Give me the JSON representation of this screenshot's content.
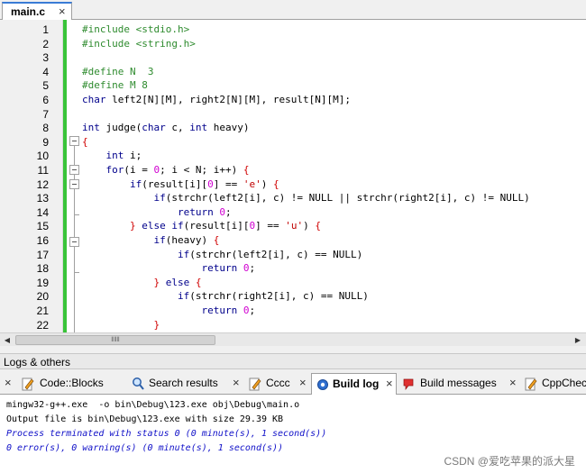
{
  "editor": {
    "tab": {
      "label": "main.c",
      "close": "×"
    },
    "lines": [
      {
        "n": "1",
        "html": "<span class=\"pp\">#include &lt;stdio.h&gt;</span>"
      },
      {
        "n": "2",
        "html": "<span class=\"pp\">#include &lt;string.h&gt;</span>"
      },
      {
        "n": "3",
        "html": ""
      },
      {
        "n": "4",
        "html": "<span class=\"pp\">#define N  3</span>"
      },
      {
        "n": "5",
        "html": "<span class=\"pp\">#define M 8</span>"
      },
      {
        "n": "6",
        "html": "<span class=\"kw\">char</span> left2[N][M], right2[N][M], result[N][M];"
      },
      {
        "n": "7",
        "html": ""
      },
      {
        "n": "8",
        "html": "<span class=\"kw\">int</span> judge(<span class=\"kw\">char</span> c, <span class=\"kw\">int</span> heavy)"
      },
      {
        "n": "9",
        "html": "<span class=\"op\">{</span>"
      },
      {
        "n": "10",
        "html": "    <span class=\"kw\">int</span> i;"
      },
      {
        "n": "11",
        "html": "    <span class=\"kw\">for</span>(i = <span class=\"num\">0</span>; i &lt; N; i++) <span class=\"op\">{</span>"
      },
      {
        "n": "12",
        "html": "        <span class=\"kw\">if</span>(result[i][<span class=\"num\">0</span>] == <span class=\"str\">'e'</span>) <span class=\"op\">{</span>"
      },
      {
        "n": "13",
        "html": "            <span class=\"kw\">if</span>(strchr(left2[i], c) != NULL || strchr(right2[i], c) != NULL)"
      },
      {
        "n": "14",
        "html": "                <span class=\"kw\">return</span> <span class=\"num\">0</span>;"
      },
      {
        "n": "15",
        "html": "        <span class=\"op\">}</span> <span class=\"kw\">else</span> <span class=\"kw\">if</span>(result[i][<span class=\"num\">0</span>] == <span class=\"str\">'u'</span>) <span class=\"op\">{</span>"
      },
      {
        "n": "16",
        "html": "            <span class=\"kw\">if</span>(heavy) <span class=\"op\">{</span>"
      },
      {
        "n": "17",
        "html": "                <span class=\"kw\">if</span>(strchr(left2[i], c) == NULL)"
      },
      {
        "n": "18",
        "html": "                    <span class=\"kw\">return</span> <span class=\"num\">0</span>;"
      },
      {
        "n": "19",
        "html": "            <span class=\"op\">}</span> <span class=\"kw\">else</span> <span class=\"op\">{</span>"
      },
      {
        "n": "20",
        "html": "                <span class=\"kw\">if</span>(strchr(right2[i], c) == NULL)"
      },
      {
        "n": "21",
        "html": "                    <span class=\"kw\">return</span> <span class=\"num\">0</span>;"
      },
      {
        "n": "22",
        "html": "            <span class=\"op\">}</span>"
      }
    ]
  },
  "scrollbar": {
    "thumb_grip": "⦀⦀⦀",
    "left_arrow": "◀",
    "right_arrow": "▶"
  },
  "logs": {
    "title": "Logs & others",
    "tabs": [
      {
        "label": "Code::Blocks",
        "icon": "pencil-icon"
      },
      {
        "label": "Search results",
        "icon": "search-icon"
      },
      {
        "label": "Cccc",
        "icon": "pencil-icon"
      },
      {
        "label": "Build log",
        "icon": "gear-icon",
        "active": true
      },
      {
        "label": "Build messages",
        "icon": "build-messages-icon"
      },
      {
        "label": "CppCheck",
        "icon": "pencil-icon"
      }
    ],
    "close": "×",
    "lines": [
      {
        "text": "mingw32-g++.exe  -o bin\\Debug\\123.exe obj\\Debug\\main.o",
        "style": "plain"
      },
      {
        "text": "Output file is bin\\Debug\\123.exe with size 29.39 KB",
        "style": "plain"
      },
      {
        "text": "Process terminated with status 0 (0 minute(s), 1 second(s))",
        "style": "blue"
      },
      {
        "text": "0 error(s), 0 warning(s) (0 minute(s), 1 second(s))",
        "style": "blue"
      }
    ]
  },
  "watermark": "CSDN @爱吃苹果的派大星",
  "colors": {
    "accent": "#3a7bd5",
    "change_bar": "#39c439",
    "preprocessor": "#2e8b2e",
    "keyword": "#00008b",
    "log_blue": "#1010c8"
  }
}
